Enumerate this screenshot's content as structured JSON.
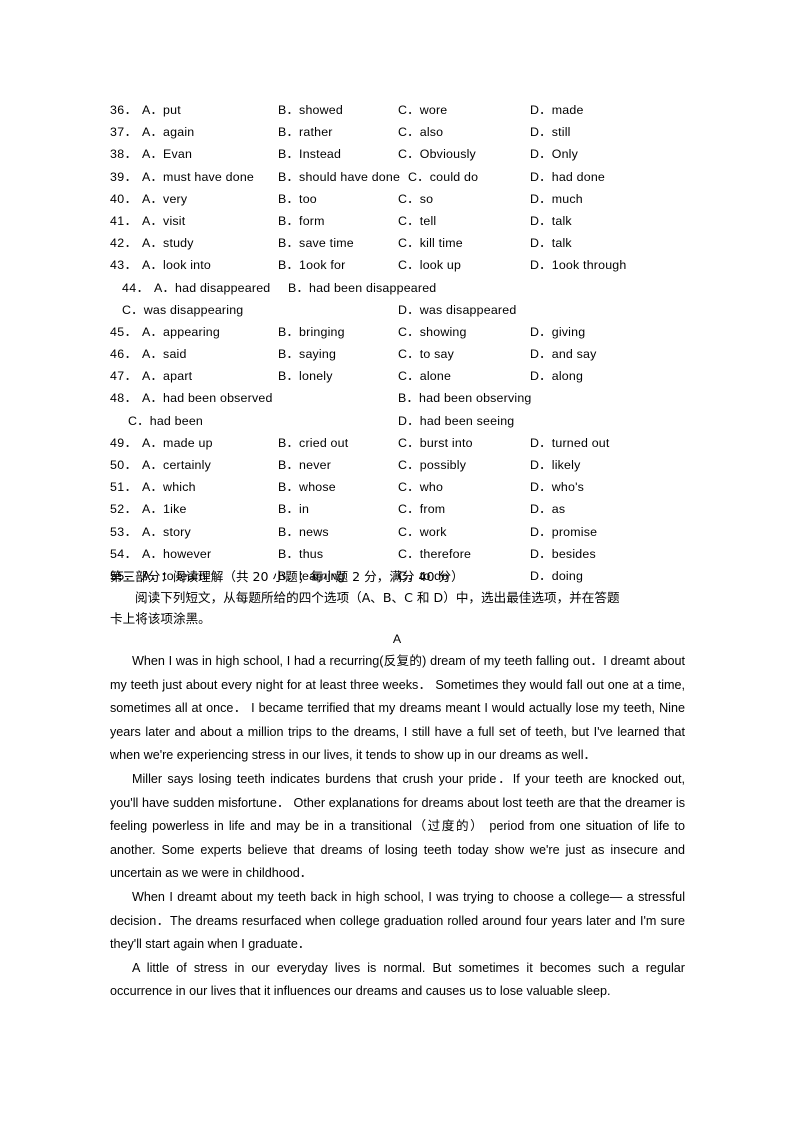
{
  "cloze": {
    "items": [
      {
        "number": "36．",
        "layout": "single",
        "options": [
          "A．put",
          "B．showed",
          "C．wore",
          "D．made"
        ]
      },
      {
        "number": "37．",
        "layout": "single",
        "options": [
          "A．again",
          "B．rather",
          "C．also",
          "D．still"
        ]
      },
      {
        "number": "38．",
        "layout": "single",
        "options": [
          "A．Evan",
          "B．Instead",
          "C．Obviously",
          "D．Only"
        ]
      },
      {
        "number": "39．",
        "layout": "wide",
        "options": [
          "A．must have done",
          "B．should have done",
          "C．could do",
          "D．had done"
        ]
      },
      {
        "number": "40．",
        "layout": "single",
        "options": [
          "A．very",
          "B．too",
          "C．so",
          "D．much"
        ]
      },
      {
        "number": "41．",
        "layout": "single",
        "options": [
          "A．visit",
          "B．form",
          "C．tell",
          "D．talk"
        ]
      },
      {
        "number": "42．",
        "layout": "single",
        "options": [
          "A．study",
          "B．save time",
          "C．kill time",
          "D．talk"
        ]
      },
      {
        "number": "43．",
        "layout": "single",
        "options": [
          "A．look into",
          "B．1ook for",
          "C．look up",
          "D．1ook through"
        ]
      },
      {
        "number": "44．",
        "layout": "double-indent",
        "options": [
          "A．had disappeared",
          "B．had been disappeared",
          "C．was disappearing",
          "D．was disappeared"
        ]
      },
      {
        "number": "45．",
        "layout": "single",
        "options": [
          "A．appearing",
          "B．bringing",
          "C．showing",
          "D．giving"
        ]
      },
      {
        "number": "46．",
        "layout": "single",
        "options": [
          "A．said",
          "B．saying",
          "C．to say",
          "D．and say"
        ]
      },
      {
        "number": "47．",
        "layout": "single",
        "options": [
          "A．apart",
          "B．lonely",
          "C．alone",
          "D．along"
        ]
      },
      {
        "number": "48．",
        "layout": "double",
        "options": [
          "A．had been observed",
          "B．had been observing",
          "C．had been",
          "D．had been seeing"
        ]
      },
      {
        "number": "49．",
        "layout": "single",
        "options": [
          "A．made up",
          "B．cried out",
          "C．burst into",
          "D．turned out"
        ]
      },
      {
        "number": "50．",
        "layout": "single",
        "options": [
          "A．certainly",
          "B．never",
          "C．possibly",
          "D．likely"
        ]
      },
      {
        "number": "51．",
        "layout": "single",
        "options": [
          "A．which",
          "B．whose",
          "C．who",
          "D．who's"
        ]
      },
      {
        "number": "52．",
        "layout": "single",
        "options": [
          "A．1ike",
          "B．in",
          "C．from",
          "D．as"
        ]
      },
      {
        "number": "53．",
        "layout": "single",
        "options": [
          "A．story",
          "B．news",
          "C．work",
          "D．promise"
        ]
      },
      {
        "number": "54．",
        "layout": "single",
        "options": [
          "A．however",
          "B．thus",
          "C．therefore",
          "D．besides"
        ]
      },
      {
        "number": "55．",
        "layout": "single",
        "options": [
          "A．to learn",
          "B．learning",
          "C．to do",
          "D．doing"
        ]
      }
    ]
  },
  "section": {
    "heading": "第三部分：阅读理解（共 20 小题；每小题 2 分，满分 40 分）",
    "instructions_line1": "阅读下列短文，从每题所给的四个选项（A、B、C 和 D）中，选出最佳选项，并在答题",
    "instructions_line2": "卡上将该项涂黑。"
  },
  "passage": {
    "label": "A",
    "paragraphs": [
      "When I was in high school, I had a recurring(反复的) dream of my teeth falling out．I dreamt about my teeth just about every night for at least three weeks． Sometimes they would fall out one at a time, sometimes all at once． I became terrified that my dreams meant I would actually lose my teeth, Nine years later and about a million trips to the dreams, I still have a full set of teeth, but I've learned that when we're experiencing stress in our lives, it tends to show up in our dreams as well．",
      "Miller says losing teeth indicates burdens that crush your pride．If your teeth are knocked out, you'll have sudden misfortune． Other explanations for dreams about lost teeth are that the dreamer is feeling powerless in life and may be in a transitional（过度的） period from one situation of life to another. Some experts believe that dreams of losing teeth today show we're just as insecure and uncertain as we were in childhood．",
      "When I dreamt about my teeth back in high school, I was trying to choose a college— a stressful decision．The dreams resurfaced when college graduation rolled around four years later and I'm sure they'll start again when I graduate．",
      "A little of stress in our everyday lives is normal. But sometimes it becomes such a regular occurrence in our lives that it influences our dreams and causes us to lose valuable sleep."
    ]
  }
}
